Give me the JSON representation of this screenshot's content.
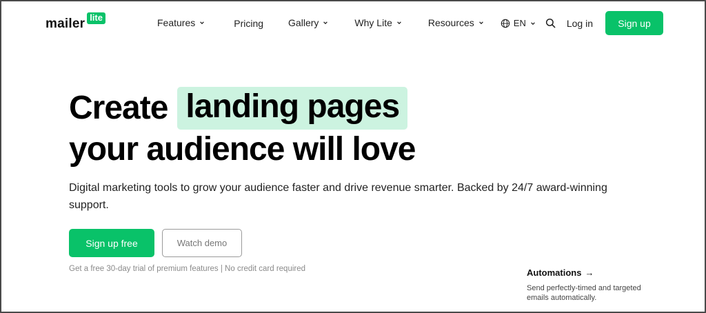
{
  "header": {
    "logo_word": "mailer",
    "logo_badge": "lite",
    "nav": [
      {
        "label": "Features",
        "has_dropdown": true
      },
      {
        "label": "Pricing",
        "has_dropdown": false
      },
      {
        "label": "Gallery",
        "has_dropdown": true
      },
      {
        "label": "Why Lite",
        "has_dropdown": true
      },
      {
        "label": "Resources",
        "has_dropdown": true
      }
    ],
    "language": "EN",
    "login_label": "Log in",
    "signup_label": "Sign up"
  },
  "hero": {
    "title_prefix": "Create",
    "title_highlight": "landing pages",
    "title_line2": "your audience will love",
    "subtitle": "Digital marketing tools to grow your audience faster and drive revenue smarter. Backed by 24/7 award-winning support.",
    "cta_primary": "Sign up free",
    "cta_secondary": "Watch demo",
    "trial_note": "Get a free 30-day trial of premium features | No credit card required"
  },
  "feature_card": {
    "title": "Automations",
    "arrow": "→",
    "description": "Send perfectly-timed and targeted emails automatically."
  },
  "colors": {
    "brand_green": "#09c269",
    "highlight_bg": "#ccf3e0"
  },
  "icons": {
    "chevron": "chevron-down-icon",
    "globe": "globe-icon",
    "search": "search-icon"
  }
}
